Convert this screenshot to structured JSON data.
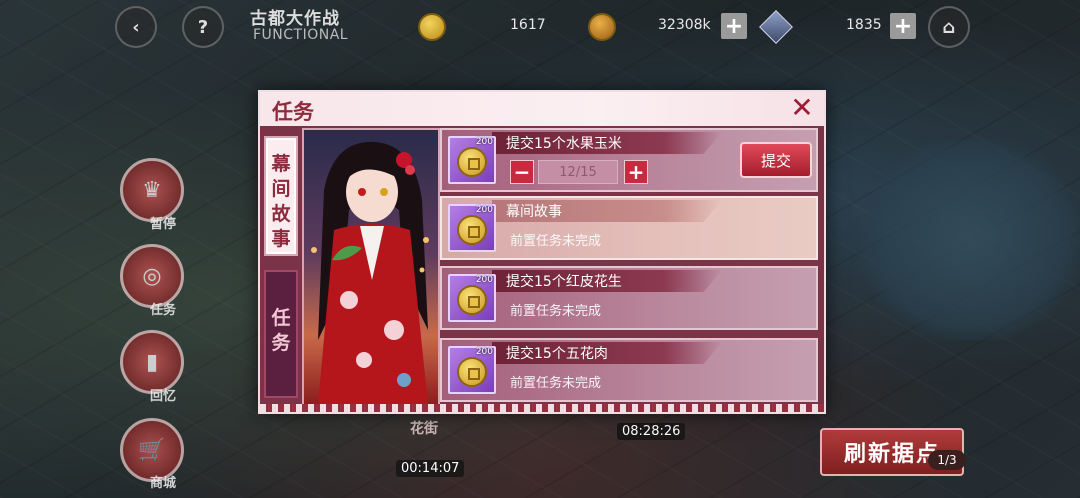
{
  "top_bar": {
    "title": "古都大作战",
    "subtitle": "FUNCTIONAL",
    "back_icon": "chevron-left-icon",
    "help_icon": "question-icon",
    "home_icon": "home-icon",
    "coin_count": "1617",
    "money_count": "32308k",
    "gem_count": "1835"
  },
  "side_menu": {
    "items": [
      {
        "label": "暂停",
        "icon": "crown-icon"
      },
      {
        "label": "任务",
        "icon": "target-icon"
      },
      {
        "label": "回忆",
        "icon": "book-icon"
      },
      {
        "label": "商城",
        "icon": "cart-icon"
      }
    ]
  },
  "map": {
    "timer_1": "00:14:07",
    "timer_2": "08:28:26",
    "district_label": "花街",
    "refresh_button": "刷新据点",
    "refresh_count": "1/3"
  },
  "dialog": {
    "title": "任务",
    "close_icon": "close-icon",
    "tabs": [
      {
        "label": [
          "幕",
          "间",
          "故",
          "事"
        ],
        "active": false
      },
      {
        "label": [
          "任",
          "务"
        ],
        "active": true
      }
    ],
    "tasks": [
      {
        "name": "提交15个水果玉米",
        "reward_count": "200",
        "quantity": "12/15",
        "submit_label": "提交"
      },
      {
        "name": "幕间故事",
        "reward_count": "200",
        "status": "前置任务未完成"
      },
      {
        "name": "提交15个红皮花生",
        "reward_count": "200",
        "status": "前置任务未完成"
      },
      {
        "name": "提交15个五花肉",
        "reward_count": "200",
        "status": "前置任务未完成"
      }
    ]
  }
}
